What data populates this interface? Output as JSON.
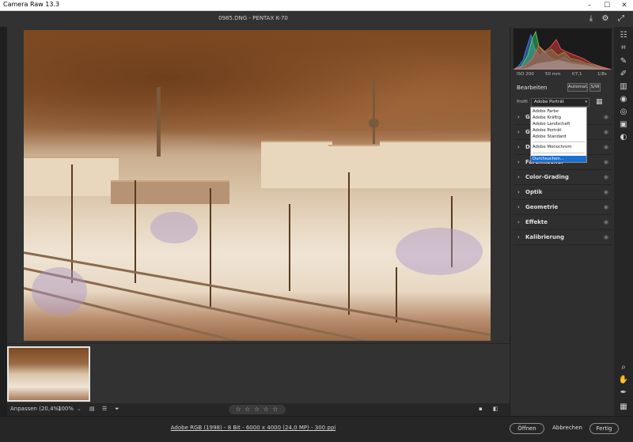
{
  "window": {
    "title": "Camera Raw 13.3"
  },
  "file": {
    "title": "0985.DNG  -  PENTAX K-70"
  },
  "camera_meta": {
    "iso": "ISO 200",
    "focal": "50 mm",
    "aperture": "f/7,1",
    "shutter": "1/8s"
  },
  "panel": {
    "heading": "Bearbeiten",
    "auto_label": "Automat.",
    "bw_label": "S/W",
    "profile_label": "Profil",
    "profile_value": "Adobe Porträt"
  },
  "profile_menu": [
    {
      "label": "Adobe Farbe",
      "selected": false
    },
    {
      "label": "Adobe Kräftig",
      "selected": false
    },
    {
      "label": "Adobe Landschaft",
      "selected": false
    },
    {
      "label": "Adobe Porträt",
      "selected": false
    },
    {
      "label": "Adobe Standard",
      "selected": false
    },
    {
      "label": "Adobe Monochrom",
      "selected": false
    },
    {
      "label": "Durchsuchen...",
      "selected": true
    }
  ],
  "sections": [
    {
      "label": "Gr"
    },
    {
      "label": "Gr"
    },
    {
      "label": "De"
    },
    {
      "label": "Farbmischer"
    },
    {
      "label": "Color-Grading"
    },
    {
      "label": "Optik"
    },
    {
      "label": "Geometrie"
    },
    {
      "label": "Effekte"
    },
    {
      "label": "Kalibrierung"
    }
  ],
  "bottom": {
    "zoom_label": "Anpassen (20,4%)",
    "zoom_pct": "100%",
    "stars": "☆ ☆ ☆ ☆ ☆"
  },
  "status": {
    "info": "Adobe RGB (1998) - 8 Bit - 6000 x 4000 (24,0 MP) - 300 ppi",
    "open_label": "Öffnen",
    "cancel_label": "Abbrechen",
    "done_label": "Fertig"
  }
}
